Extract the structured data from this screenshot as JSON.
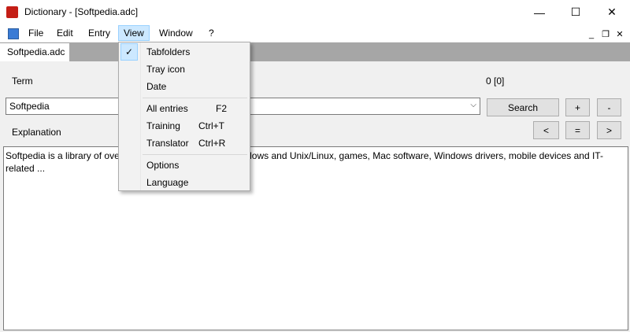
{
  "window": {
    "title": "Dictionary - [Softpedia.adc]",
    "minimize_glyph": "—",
    "maximize_glyph": "☐",
    "close_glyph": "✕"
  },
  "menubar": {
    "items": [
      "File",
      "Edit",
      "Entry",
      "View",
      "Window",
      "?"
    ]
  },
  "mdi": {
    "minimize": "_",
    "restore": "❐",
    "close": "✕"
  },
  "tabs": [
    {
      "label": "Softpedia.adc",
      "active": true
    }
  ],
  "form": {
    "term_label": "Term",
    "count": "0 [0]",
    "term_value": "Softpedia",
    "search_label": "Search",
    "plus_label": "+",
    "minus_label": "-",
    "explanation_label": "Explanation",
    "prev_label": "<",
    "equal_label": "=",
    "next_label": ">",
    "explanation_text": "Softpedia is a library of over ... software programs for Windows and Unix/Linux, games, Mac software, Windows drivers, mobile devices and IT-related ..."
  },
  "view_menu": {
    "items": [
      {
        "label": "Tabfolders",
        "shortcut": "",
        "checked": true
      },
      {
        "label": "Tray icon",
        "shortcut": ""
      },
      {
        "label": "Date",
        "shortcut": ""
      },
      {
        "label": "All entries",
        "shortcut": "F2"
      },
      {
        "label": "Training",
        "shortcut": "Ctrl+T"
      },
      {
        "label": "Translator",
        "shortcut": "Ctrl+R"
      },
      {
        "label": "Options",
        "shortcut": ""
      },
      {
        "label": "Language",
        "shortcut": ""
      }
    ],
    "check_glyph": "✓"
  },
  "colors": {
    "menu_highlight": "#cce8ff",
    "tab_strip": "#a6a6a6",
    "app_icon": "#c41e16"
  }
}
